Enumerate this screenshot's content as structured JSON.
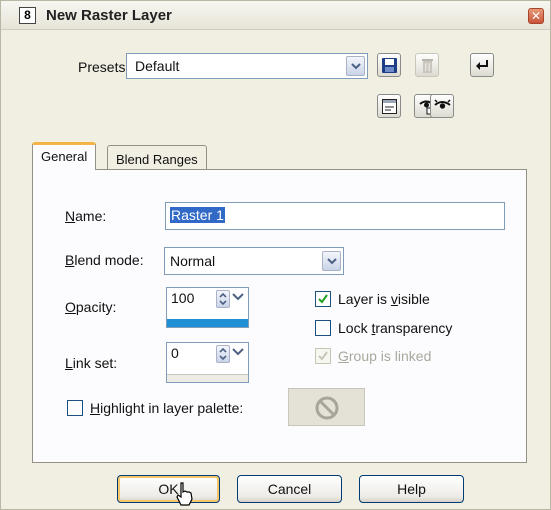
{
  "window": {
    "title": "New Raster Layer",
    "app_icon_text": "8",
    "close_glyph": "✕"
  },
  "presets": {
    "label": "Presets:",
    "selected": "Default",
    "icons": [
      "save-icon",
      "delete-icon",
      "reset-icon",
      "dialog-icon",
      "copy-settings-icon",
      "eye-icon"
    ]
  },
  "tabs": [
    {
      "label": "General",
      "active": true
    },
    {
      "label": "Blend Ranges",
      "active": false
    }
  ],
  "general": {
    "name": {
      "label": "Name:",
      "underline": "N",
      "rest": "ame:",
      "value": "Raster 1"
    },
    "blend_mode": {
      "label": "Blend mode:",
      "underline": "B",
      "rest": "lend mode:",
      "selected": "Normal"
    },
    "opacity": {
      "label": "Opacity:",
      "underline": "O",
      "rest": "pacity:",
      "value": "100"
    },
    "link_set": {
      "label": "Link set:",
      "underline": "L",
      "rest": "ink set:",
      "value": "0"
    },
    "layer_visible": {
      "pre": "Layer is ",
      "underline": "v",
      "post": "isible",
      "checked": true
    },
    "lock_transparency": {
      "pre": "Lock ",
      "underline": "t",
      "post": "ransparency",
      "checked": false
    },
    "group_linked": {
      "pre": "",
      "underline": "G",
      "post": "roup is linked",
      "checked": true,
      "disabled": true
    },
    "highlight": {
      "pre": "",
      "underline": "H",
      "post": "ighlight in layer palette:",
      "checked": false
    }
  },
  "buttons": {
    "ok": "OK",
    "cancel": "Cancel",
    "help": "Help"
  },
  "colors": {
    "selection": "#3169c6",
    "opacity_bar": "#1f8fd6",
    "tab_accent": "#f4b445"
  }
}
